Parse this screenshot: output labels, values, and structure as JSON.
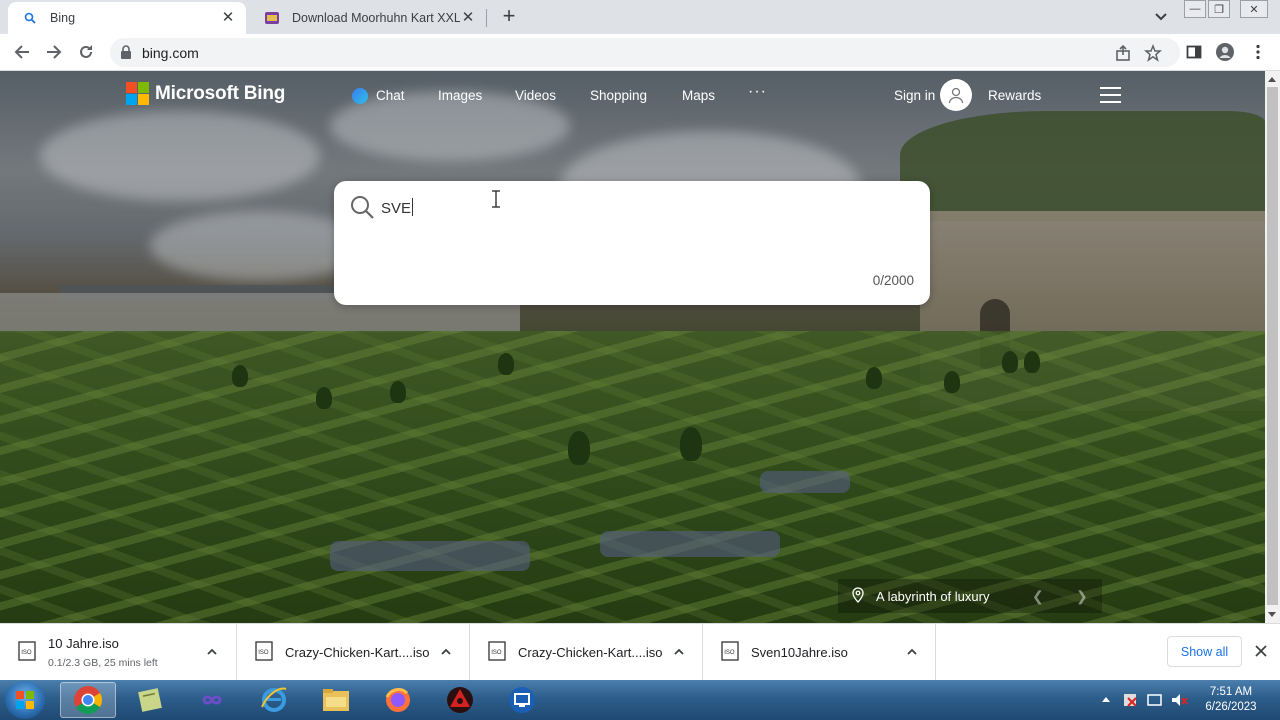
{
  "browser": {
    "tabs": [
      {
        "title": "Bing",
        "active": true
      },
      {
        "title": "Download Moorhuhn Kart XXL (W",
        "active": false
      }
    ],
    "url": "bing.com"
  },
  "bing": {
    "logo_text": "Microsoft Bing",
    "nav": {
      "chat": "Chat",
      "images": "Images",
      "videos": "Videos",
      "shopping": "Shopping",
      "maps": "Maps",
      "more": "···"
    },
    "sign_in": "Sign in",
    "rewards": "Rewards",
    "search": {
      "query": "SVE",
      "counter": "0/2000"
    },
    "image_caption": "A labyrinth of luxury",
    "colors": {
      "red": "#f25022",
      "green": "#7fba00",
      "blue": "#00a4ef",
      "yellow": "#ffb900"
    }
  },
  "downloads": {
    "items": [
      {
        "name": "10 Jahre.iso",
        "status": "0.1/2.3 GB, 25 mins left"
      },
      {
        "name": "Crazy-Chicken-Kart....iso",
        "status": ""
      },
      {
        "name": "Crazy-Chicken-Kart....iso",
        "status": ""
      },
      {
        "name": "Sven10Jahre.iso",
        "status": ""
      }
    ],
    "show_all": "Show all"
  },
  "taskbar": {
    "time": "7:51 AM",
    "date": "6/26/2023"
  }
}
